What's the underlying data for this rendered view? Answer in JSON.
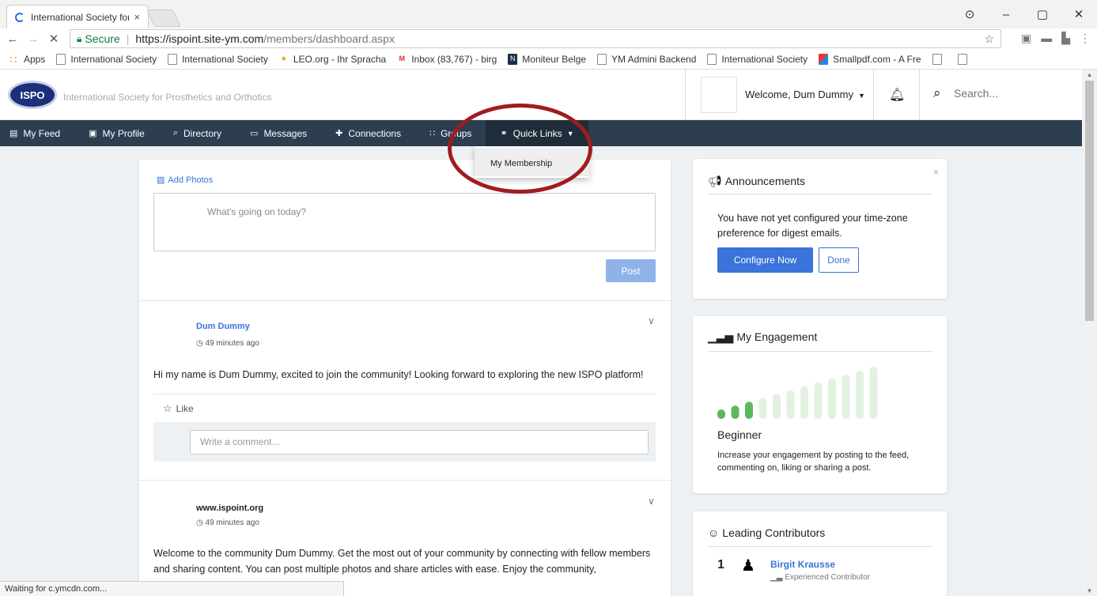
{
  "browser": {
    "tab_title": "International Society for",
    "tab_close": "×",
    "url_secure": "Secure",
    "url_host": "https://ispoint.site-ym.com",
    "url_path": "/members/dashboard.aspx",
    "bookmarks": [
      {
        "label": "Apps",
        "icon": "apps-icon"
      },
      {
        "label": "International Society",
        "icon": "page-icon"
      },
      {
        "label": "International Society",
        "icon": "page-icon"
      },
      {
        "label": "LEO.org - Ihr Spracha",
        "icon": "leo-icon"
      },
      {
        "label": "Inbox (83,767) - birg",
        "icon": "gmail-icon"
      },
      {
        "label": "Moniteur Belge",
        "icon": "mb-icon"
      },
      {
        "label": "YM Admini Backend",
        "icon": "page-icon"
      },
      {
        "label": "International Society",
        "icon": "page-icon"
      },
      {
        "label": "Smallpdf.com - A Fre",
        "icon": "smallpdf-icon"
      }
    ],
    "status": "Waiting for c.ymcdn.com..."
  },
  "header": {
    "logo_text": "ISPO",
    "site_name": "International Society for Prosthetics and Orthotics",
    "welcome": "Welcome, Dum Dummy",
    "search_placeholder": "Search..."
  },
  "nav": {
    "items": [
      {
        "label": "My Feed",
        "icon": "feed-icon"
      },
      {
        "label": "My Profile",
        "icon": "profile-icon"
      },
      {
        "label": "Directory",
        "icon": "search-icon"
      },
      {
        "label": "Messages",
        "icon": "inbox-icon"
      },
      {
        "label": "Connections",
        "icon": "connections-icon"
      },
      {
        "label": "Groups",
        "icon": "groups-icon"
      },
      {
        "label": "Quick Links",
        "icon": "link-icon"
      }
    ],
    "dropdown_item": "My Membership"
  },
  "composer": {
    "add_photos": "Add Photos",
    "placeholder": "What's going on today?",
    "post_label": "Post"
  },
  "posts": [
    {
      "author": "Dum Dummy",
      "time": "49 minutes ago",
      "body": "Hi my name is Dum Dummy, excited to join the community! Looking forward to exploring the new ISPO platform!",
      "like": "Like",
      "comment_placeholder": "Write a comment..."
    },
    {
      "author": "www.ispoint.org",
      "time": "49 minutes ago",
      "body": "Welcome to the community Dum Dummy. Get the most out of your community by connecting with fellow members and sharing content. You can post multiple photos and share articles with ease. Enjoy the community,"
    }
  ],
  "announcements": {
    "title": "Announcements",
    "text": "You have not yet configured your time-zone preference for digest emails.",
    "configure": "Configure Now",
    "done": "Done",
    "close": "×"
  },
  "engagement": {
    "title": "My Engagement",
    "level": "Beginner",
    "desc": "Increase your engagement by posting to the feed, commenting on, liking or sharing a post.",
    "filled_bars": 3,
    "total_bars": 12,
    "color_filled": "#5cb85c",
    "color_empty": "#e3f1e1"
  },
  "contributors": {
    "title": "Leading Contributors",
    "items": [
      {
        "rank": "1",
        "name": "Birgit Krausse",
        "level": "Experienced Contributor"
      }
    ]
  }
}
